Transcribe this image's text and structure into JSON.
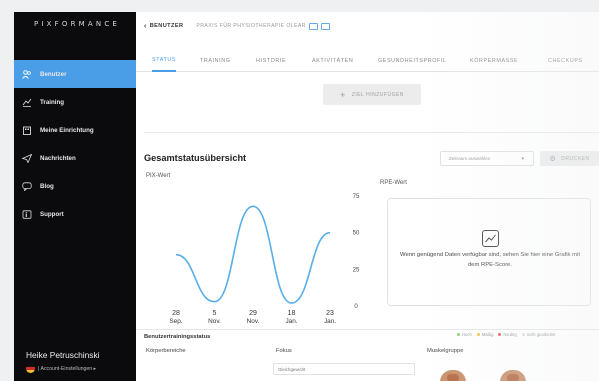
{
  "app": {
    "logo_text": "PIXFORMANCE"
  },
  "sidebar": {
    "items": [
      {
        "label": "Benutzer",
        "icon": "users-icon",
        "active": true
      },
      {
        "label": "Training",
        "icon": "training-icon",
        "active": false
      },
      {
        "label": "Meine Einrichtung",
        "icon": "building-icon",
        "active": false
      },
      {
        "label": "Nachrichten",
        "icon": "send-icon",
        "active": false
      },
      {
        "label": "Blog",
        "icon": "chat-icon",
        "active": false
      },
      {
        "label": "Support",
        "icon": "support-icon",
        "active": false
      }
    ],
    "user": {
      "name": "Heike Petruschinski",
      "account_label": "| Account-Einstellungen ▸"
    }
  },
  "topbar": {
    "back_label": "BENUTZER",
    "practice_label": "PRAXIS FÜR PHYSIOTHERAPIE OLEAR"
  },
  "tabs": [
    {
      "label": "STATUS",
      "active": true
    },
    {
      "label": "TRAINING",
      "active": false
    },
    {
      "label": "HISTORIE",
      "active": false
    },
    {
      "label": "AKTIVITÄTEN",
      "active": false
    },
    {
      "label": "GESUNDHEITSPROFIL",
      "active": false
    },
    {
      "label": "KÖRPERMASSE",
      "active": false
    },
    {
      "label": "CHECKUPS",
      "active": false
    }
  ],
  "goals": {
    "add_label": "ZIEL HINZUFÜGEN"
  },
  "overview": {
    "title": "Gesamtstatusübersicht",
    "date_placeholder": "Zeitraum auswählen",
    "print_label": "DRUCKEN"
  },
  "chart_data": {
    "type": "line",
    "title": "PIX-Wert",
    "x": [
      "28 Sep.",
      "5 Nov.",
      "29 Nov.",
      "18 Jan.",
      "23 Jan."
    ],
    "x_labels": [
      {
        "day": "28",
        "month": "Sep."
      },
      {
        "day": "5",
        "month": "Nov."
      },
      {
        "day": "29",
        "month": "Nov."
      },
      {
        "day": "18",
        "month": "Jan."
      },
      {
        "day": "23",
        "month": "Jan."
      }
    ],
    "y_ticks": [
      75,
      50,
      25,
      0
    ],
    "ylim": [
      0,
      75
    ],
    "series": [
      {
        "values": [
          35,
          3,
          68,
          2,
          50
        ],
        "color": "#5aaee8"
      }
    ],
    "smooth": true,
    "grid": false
  },
  "rpe": {
    "label": "RPE-Wert",
    "message": "Wenn genügend Daten verfügbar sind, sehen Sie hier eine Grafik mit dem RPE-Score."
  },
  "training_status": {
    "title": "Benutzertrainingsstatus",
    "legend": [
      {
        "label": "Hoch",
        "color": "#8fd07a"
      },
      {
        "label": "Mäßig",
        "color": "#f4c24a"
      },
      {
        "label": "Niedrig",
        "color": "#e8545a"
      },
      {
        "label": "nicht gearbeitet",
        "color": "#dddddd"
      }
    ],
    "columns": {
      "body_areas": "Körperbereiche",
      "focus": "Fokus",
      "muscle_group": "Muskelgruppe"
    },
    "focus_value": "Gleichgewicht"
  }
}
